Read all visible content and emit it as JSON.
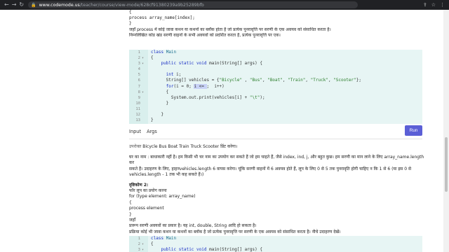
{
  "browser": {
    "back": "←",
    "forward": "→",
    "reload": "↻",
    "url_domain": "www.codemode.us",
    "url_path": "/teacher/course/view-mode/628cf91380239a9b25289bfb",
    "tool_icons": [
      "⇪",
      "☆",
      "⋮"
    ]
  },
  "intro": {
    "lines": [
      "{",
      "process  array_name[index];",
      "}",
      "जहाँ process  में कोई जावा कथन या कथनों का ब्लॉक होता है जो प्रत्येक पुनरावृत्ति पर सरणी के एक अवयव को संसाधित करता है।",
      "निम्नलिखित कोड खंड सरणी वाहनों के सभी अवयवों को प्रदर्शित करता है, प्रत्येक पुनरावृत्ति पर एक।"
    ]
  },
  "editor1": {
    "lines": [
      {
        "n": "1",
        "fold": "",
        "tokens": [
          [
            "kw",
            "class "
          ],
          [
            "cls",
            "Main"
          ]
        ]
      },
      {
        "n": "2",
        "fold": "▾",
        "tokens": [
          [
            "",
            "{"
          ]
        ]
      },
      {
        "n": "3",
        "fold": "▾",
        "tokens": [
          [
            "",
            "    "
          ],
          [
            "kw",
            "public static void "
          ],
          [
            "",
            "main(String[] args) {"
          ]
        ]
      },
      {
        "n": "4",
        "fold": "",
        "tokens": [
          [
            "",
            "      "
          ]
        ]
      },
      {
        "n": "5",
        "fold": "",
        "tokens": [
          [
            "",
            "      "
          ],
          [
            "kw",
            "int "
          ],
          [
            "",
            "i;"
          ]
        ]
      },
      {
        "n": "6",
        "fold": "",
        "tokens": [
          [
            "",
            "      String[] vehicles = {"
          ],
          [
            "str",
            "\"Bicycle\""
          ],
          [
            "",
            " , "
          ],
          [
            "str",
            "\"Bus\""
          ],
          [
            "",
            ", "
          ],
          [
            "str",
            "\"Boat\""
          ],
          [
            "",
            ", "
          ],
          [
            "str",
            "\"Train\""
          ],
          [
            "",
            ", "
          ],
          [
            "str",
            "\"Truck\""
          ],
          [
            "",
            ", "
          ],
          [
            "str",
            "\"Scooter\""
          ],
          [
            "",
            "};"
          ]
        ]
      },
      {
        "n": "7",
        "fold": "",
        "tokens": [
          [
            "",
            "      "
          ],
          [
            "kw",
            "for"
          ],
          [
            "",
            "(i = 0; "
          ],
          [
            "sel",
            "i <= "
          ],
          [
            "",
            ";  i++)"
          ]
        ]
      },
      {
        "n": "8",
        "fold": "▾",
        "tokens": [
          [
            "",
            "      {"
          ]
        ]
      },
      {
        "n": "9",
        "fold": "",
        "tokens": [
          [
            "",
            "        System.out.print(vehicles[i] + "
          ],
          [
            "str",
            "\"\\t\""
          ],
          [
            "",
            ");"
          ]
        ]
      },
      {
        "n": "10",
        "fold": "",
        "tokens": [
          [
            "",
            "      }"
          ]
        ]
      },
      {
        "n": "11",
        "fold": "",
        "tokens": [
          [
            "",
            ""
          ]
        ]
      },
      {
        "n": "12",
        "fold": "",
        "tokens": [
          [
            "",
            "    }"
          ]
        ]
      },
      {
        "n": "13",
        "fold": "",
        "tokens": [
          [
            "",
            "}"
          ]
        ]
      }
    ]
  },
  "io": {
    "input_tab": "Input",
    "args_tab": "Args",
    "run_label": "Run"
  },
  "output": {
    "label": "उपरोक्त",
    "values": "Bicycle   Bus   Boat   Train   Truck   Scooter",
    "suffix": "प्रिंट करेगा।"
  },
  "body2": {
    "p1": [
      "घर का नाम : बाधाकारी नहीं है। हम किसी भी चर नाम का उपयोग कर सकते हैं जो हम चाहते हैं, जैसे index, ind, j, और बहुत कुछ। हम सरणी का मान लाने के लिए array_name.length कर",
      "सकते हैं। उदाहरण के लिए, हाहनvehicles.length 6 वापस करेगा। चूंकि सरणी वाहनों में 6 अवयव होते हैं, लूप के लिए 0 से 5 तक पुनरावृति होगी चाहिए न कि 1 से 6 (या इस 0 से",
      "vehicles.length - 1 तक भी कह सकते हैं।)"
    ],
    "heading": "दृष्टिकोण 2:",
    "p2": [
      "फॉर लूप का प्रयोग करना",
      "for (type element: array_name)",
      "{",
      "  process element",
      "}",
      "जहाँ",
      "प्रारूप सरणी अवयवों का प्रकार है। यह int, double, String आदि हो सकता है।",
      "प्रक्रिया कोई भी जावा कथन या कथनों का ब्लॉक है जो प्रत्येक पुनरावृत्ति पर सरणी के एक अवयव को संसाधित करता है। नीचे उदाहरण देखें।"
    ]
  },
  "editor2": {
    "lines": [
      {
        "n": "1",
        "fold": "",
        "tokens": [
          [
            "kw",
            "class "
          ],
          [
            "cls",
            "Main"
          ]
        ]
      },
      {
        "n": "2",
        "fold": "▾",
        "tokens": [
          [
            "",
            "{"
          ]
        ]
      },
      {
        "n": "3",
        "fold": "▾",
        "tokens": [
          [
            "",
            "    "
          ],
          [
            "kw",
            "public static void "
          ],
          [
            "",
            "main(String[] args) {"
          ]
        ]
      }
    ]
  }
}
